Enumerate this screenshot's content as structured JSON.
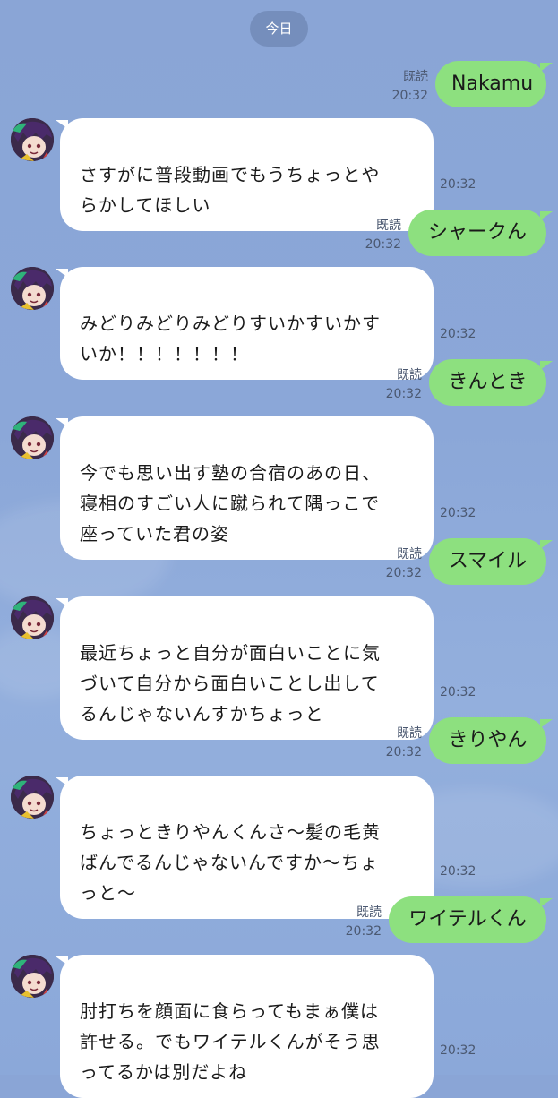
{
  "date_label": "今日",
  "read_label": "既読",
  "colors": {
    "background": "#8ba7d8",
    "outgoing_bubble": "#8de07f",
    "incoming_bubble": "#ffffff",
    "date_pill": "#5a6f9a"
  },
  "messages": [
    {
      "direction": "out",
      "text": "Nakamu",
      "read": "既読",
      "time": "20:32"
    },
    {
      "direction": "in",
      "text": "さすがに普段動画でもうちょっとや\nらかしてほしい",
      "time": "20:32",
      "avatar": "purple-hair-avatar"
    },
    {
      "direction": "out",
      "text": "シャークん",
      "read": "既読",
      "time": "20:32"
    },
    {
      "direction": "in",
      "text": "みどりみどりみどりすいかすいかす\nいか！！！！！！！",
      "time": "20:32",
      "avatar": "purple-hair-avatar"
    },
    {
      "direction": "out",
      "text": "きんとき",
      "read": "既読",
      "time": "20:32"
    },
    {
      "direction": "in",
      "text": "今でも思い出す塾の合宿のあの日、\n寝相のすごい人に蹴られて隅っこで\n座っていた君の姿",
      "time": "20:32",
      "avatar": "purple-hair-avatar"
    },
    {
      "direction": "out",
      "text": "スマイル",
      "read": "既読",
      "time": "20:32"
    },
    {
      "direction": "in",
      "text": "最近ちょっと自分が面白いことに気\nづいて自分から面白いことし出して\nるんじゃないんすかちょっと",
      "time": "20:32",
      "avatar": "purple-hair-avatar"
    },
    {
      "direction": "out",
      "text": "きりやん",
      "read": "既読",
      "time": "20:32"
    },
    {
      "direction": "in",
      "text": "ちょっときりやんくんさ〜髪の毛黄\nばんでるんじゃないんですか〜ちょ\nっと〜",
      "time": "20:32",
      "avatar": "purple-hair-avatar"
    },
    {
      "direction": "out",
      "text": "ワイテルくん",
      "read": "既読",
      "time": "20:32"
    },
    {
      "direction": "in",
      "text": "肘打ちを顔面に食らってもまぁ僕は\n許せる。でもワイテルくんがそう思\nってるかは別だよね",
      "time": "20:32",
      "avatar": "purple-hair-avatar"
    }
  ]
}
